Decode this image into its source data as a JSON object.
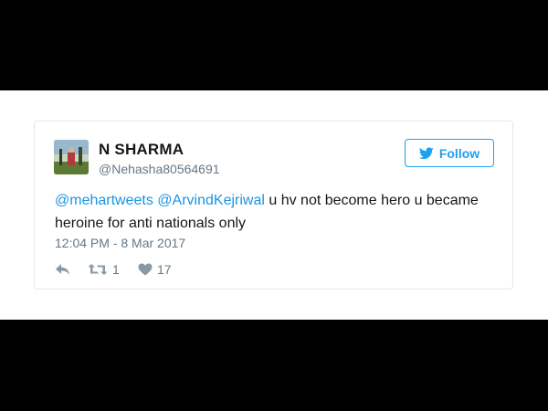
{
  "tweet": {
    "author_name": "N SHARMA",
    "author_handle": "@Nehasha80564691",
    "follow_label": "Follow",
    "mention_1": "@mehartweets",
    "mention_2": "@ArvindKejriwal",
    "body_text": " u hv not become hero u became heroine for anti nationals only",
    "timestamp": "12:04 PM - 8 Mar 2017",
    "retweet_count": "1",
    "like_count": "17"
  },
  "icons": {
    "follow": "twitter-bird-icon",
    "reply": "reply-icon",
    "retweet": "retweet-icon",
    "like": "heart-icon"
  },
  "colors": {
    "accent": "#1da1f2",
    "mention": "#1b95e0",
    "muted": "#657786",
    "text": "#14171a"
  }
}
